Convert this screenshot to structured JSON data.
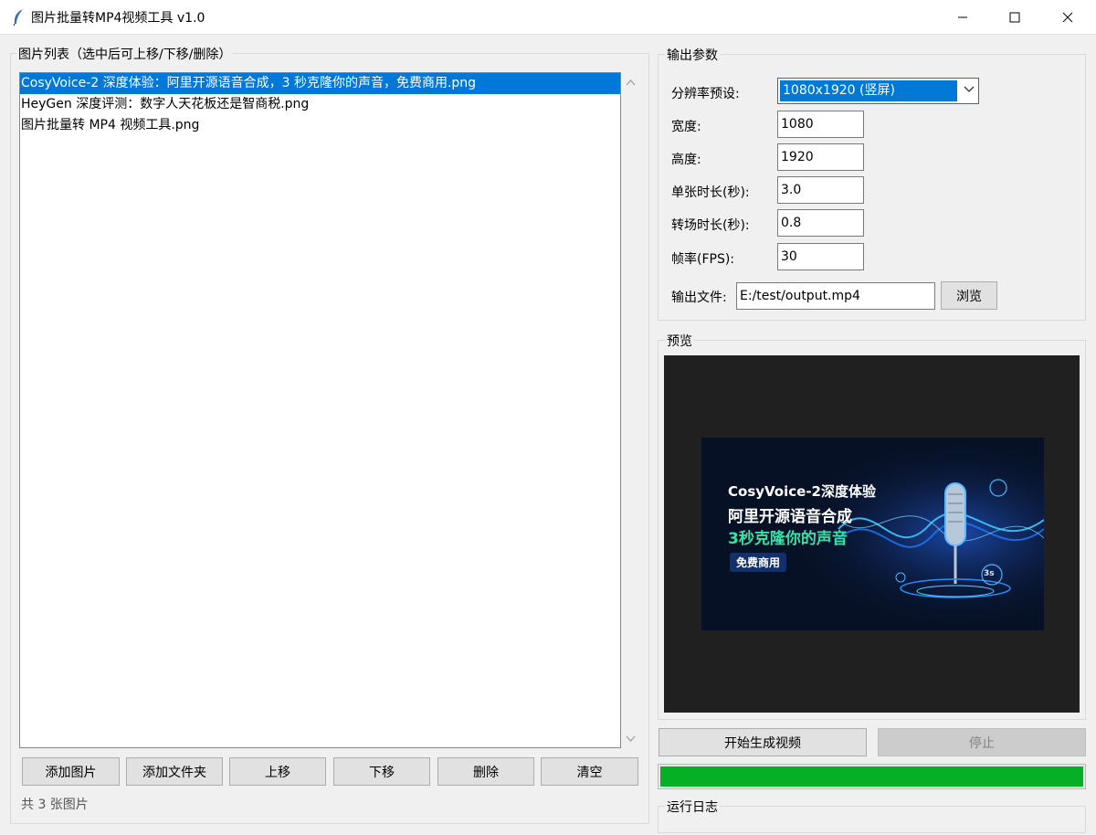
{
  "window": {
    "title": "图片批量转MP4视频工具 v1.0",
    "controls": {
      "minimize": "minimize-icon",
      "maximize": "maximize-icon",
      "close": "close-icon"
    }
  },
  "image_list": {
    "group_label": "图片列表（选中后可上移/下移/删除）",
    "items": [
      "CosyVoice-2 深度体验：阿里开源语音合成，3 秒克隆你的声音，免费商用.png",
      "HeyGen 深度评测：数字人天花板还是智商税.png",
      "图片批量转 MP4 视频工具.png"
    ],
    "selected_index": 0,
    "buttons": {
      "add_images": "添加图片",
      "add_folder": "添加文件夹",
      "move_up": "上移",
      "move_down": "下移",
      "delete": "删除",
      "clear": "清空"
    },
    "count_text": "共 3 张图片"
  },
  "output_params": {
    "group_label": "输出参数",
    "resolution_label": "分辨率预设:",
    "resolution_value": "1080x1920 (竖屏)",
    "width_label": "宽度:",
    "width_value": "1080",
    "height_label": "高度:",
    "height_value": "1920",
    "duration_label": "单张时长(秒):",
    "duration_value": "3.0",
    "transition_label": "转场时长(秒):",
    "transition_value": "0.8",
    "fps_label": "帧率(FPS):",
    "fps_value": "30",
    "output_label": "输出文件:",
    "output_value": "E:/test/output.mp4",
    "browse_button": "浏览"
  },
  "preview": {
    "group_label": "预览",
    "thumb_line1": "CosyVoice-2深度体验",
    "thumb_line2": "阿里开源语音合成",
    "thumb_line3": "3秒克隆你的声音",
    "thumb_badge": "免费商用",
    "thumb_3s": "3s"
  },
  "actions": {
    "start_button": "开始生成视频",
    "stop_button": "停止"
  },
  "progress": {
    "value": 1.0,
    "color": "#06b025"
  },
  "log": {
    "group_label": "运行日志"
  },
  "colors": {
    "selection": "#0078d7",
    "background": "#f0f0f0"
  }
}
